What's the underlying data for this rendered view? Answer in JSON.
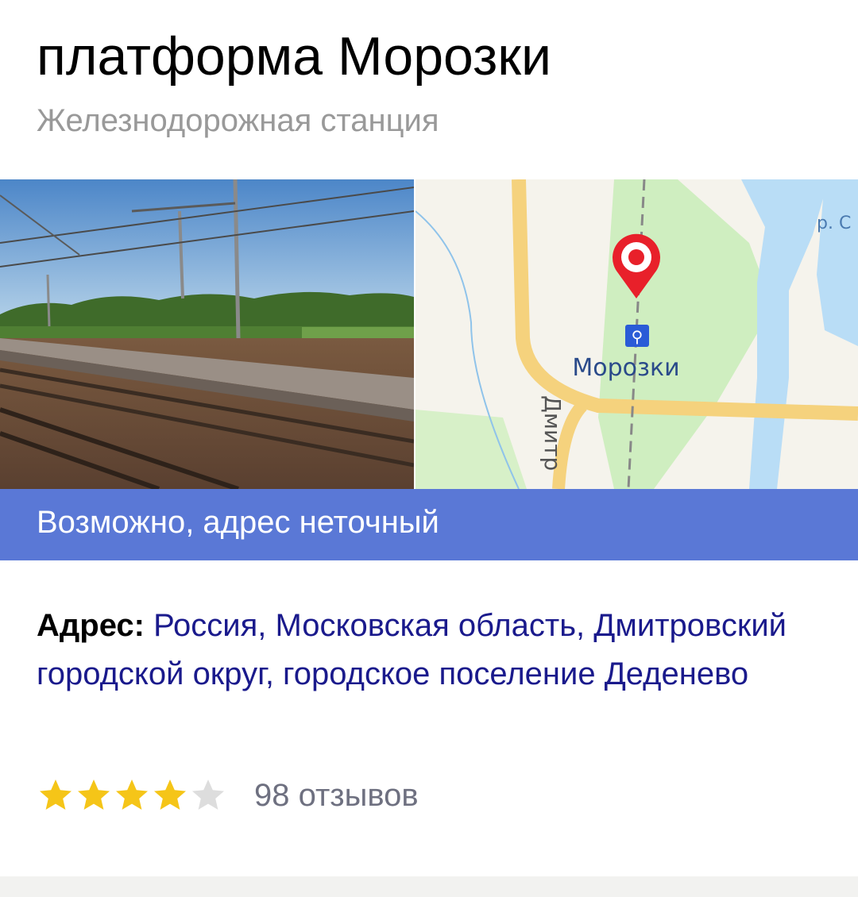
{
  "header": {
    "title": "платформа Морозки",
    "subtitle": "Железнодорожная станция"
  },
  "map": {
    "station_label": "Морозки",
    "road_label": "Дмитр",
    "river_label": "р. С",
    "pin_color": "#e8202a"
  },
  "banner": {
    "text": "Возможно, адрес неточный",
    "color": "#5a78d6"
  },
  "address": {
    "label": "Адрес:",
    "value": "Россия, Московская область, Дмитровский городской округ, городское поселение Деденево"
  },
  "rating": {
    "value": 4,
    "max": 5,
    "reviews_text": "98 отзывов",
    "star_color": "#f5c518",
    "empty_star_color": "#dddddd"
  }
}
